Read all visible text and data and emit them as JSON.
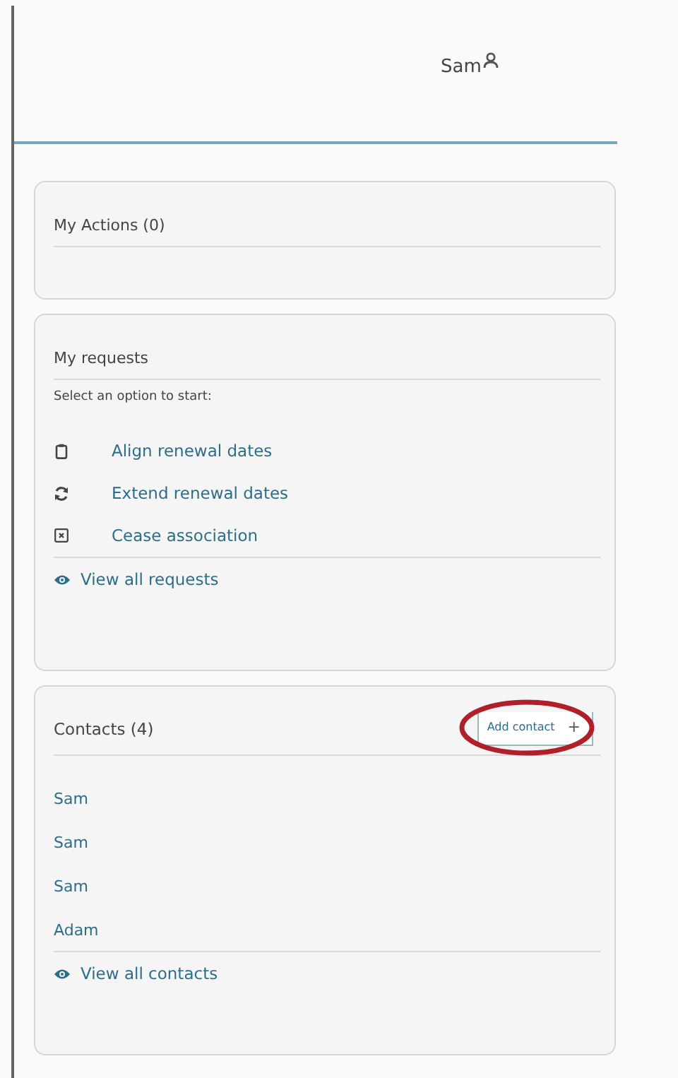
{
  "header": {
    "user_name": "Sam"
  },
  "actions_card": {
    "title": "My Actions (0)"
  },
  "requests_card": {
    "title": "My requests",
    "hint": "Select an option to start:",
    "options": [
      {
        "label": "Align renewal dates"
      },
      {
        "label": "Extend renewal dates"
      },
      {
        "label": "Cease association"
      }
    ],
    "view_all": "View all requests"
  },
  "contacts_card": {
    "title": "Contacts (4)",
    "add_button": {
      "label": "Add contact",
      "icon": "+",
      "highlighted": true
    },
    "contacts": [
      "Sam",
      "Sam",
      "Sam",
      "Adam"
    ],
    "view_all": "View all contacts"
  }
}
